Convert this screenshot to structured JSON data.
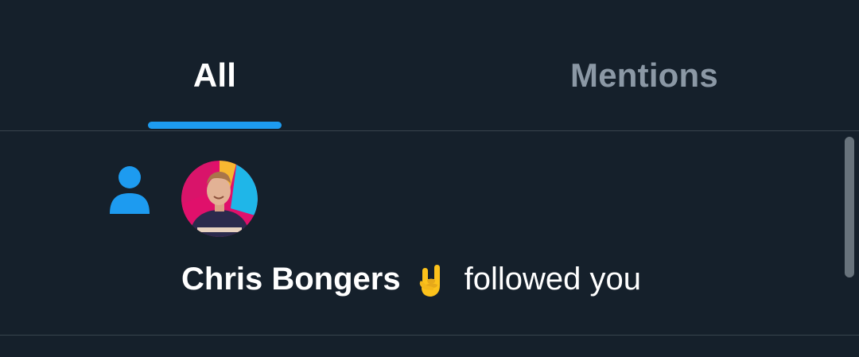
{
  "tabs": [
    {
      "label": "All",
      "selected": true
    },
    {
      "label": "Mentions",
      "selected": false
    }
  ],
  "notification": {
    "type_icon": "person-icon",
    "avatar_icon": "user-avatar",
    "user_name": "Chris Bongers",
    "emoji": "sign-of-the-horns",
    "action_text": "followed you"
  },
  "colors": {
    "background": "#15202b",
    "accent": "#1d9bf0",
    "divider": "#38444d",
    "inactive_tab": "#8b98a5",
    "text": "#ffffff"
  }
}
